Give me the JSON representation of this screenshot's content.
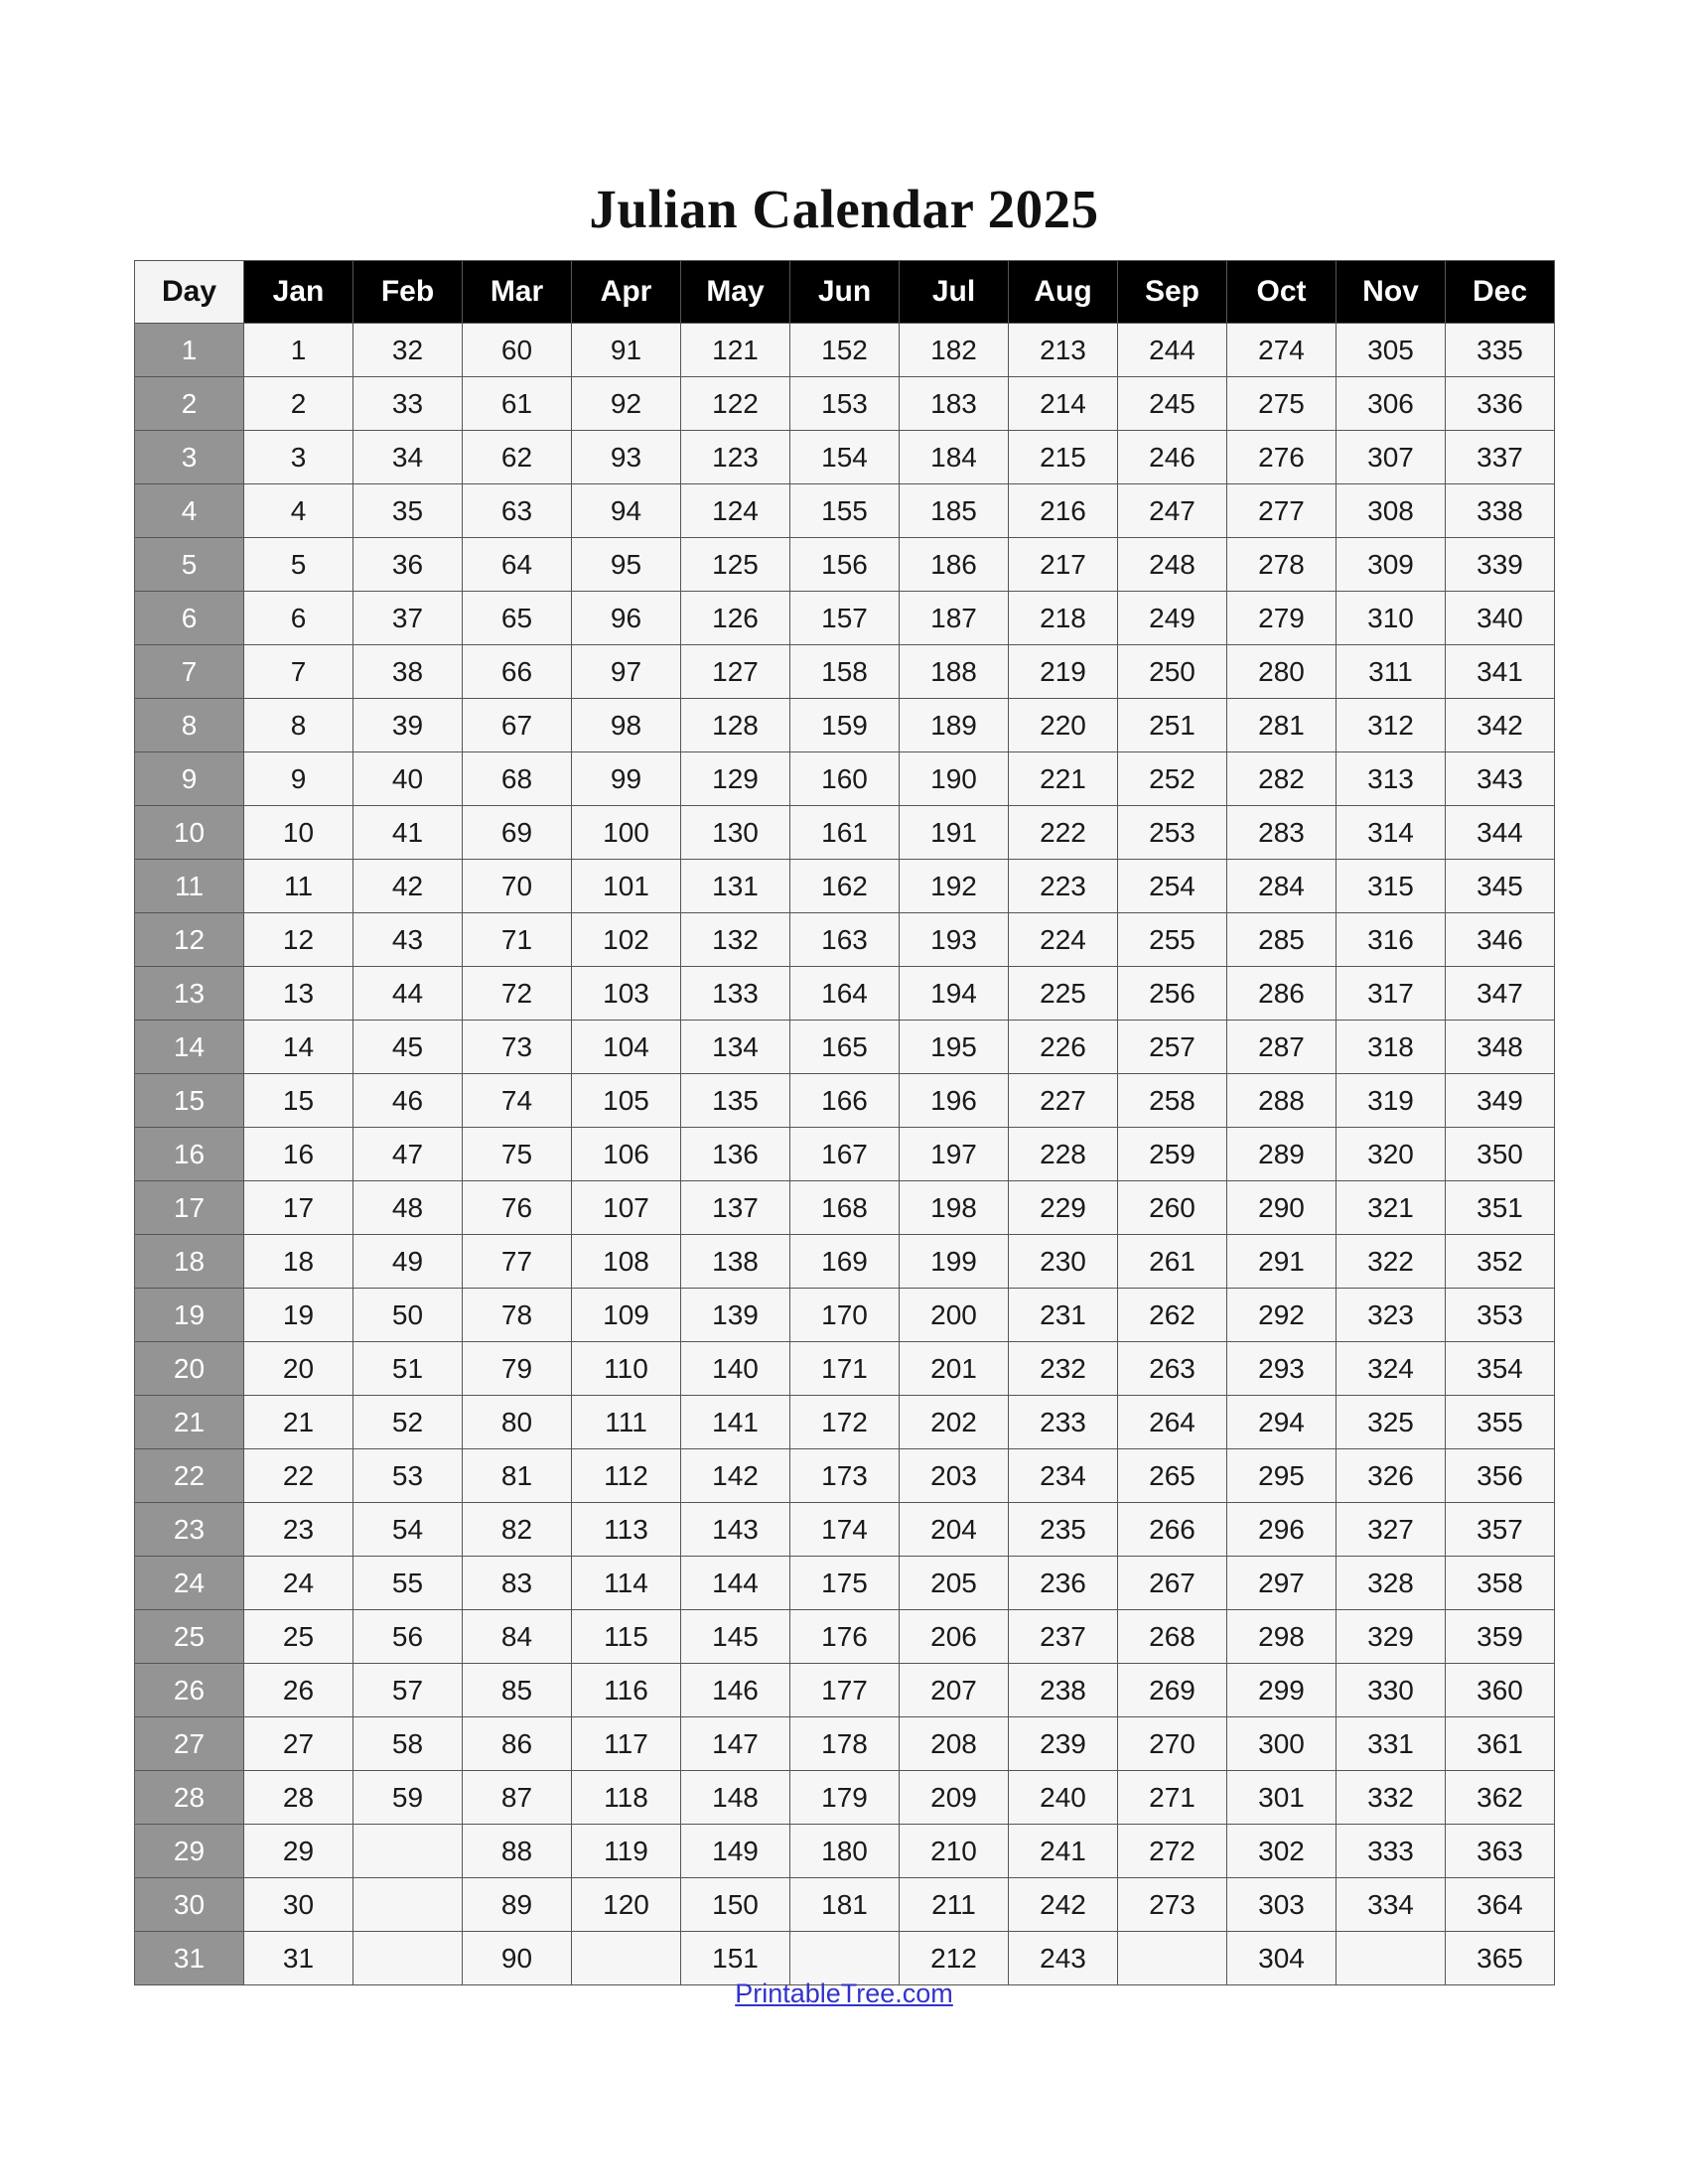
{
  "document": {
    "title": "Julian Calendar 2025",
    "year": "2025"
  },
  "table": {
    "day_header": "Day",
    "month_headers": [
      "Jan",
      "Feb",
      "Mar",
      "Apr",
      "May",
      "Jun",
      "Jul",
      "Aug",
      "Sep",
      "Oct",
      "Nov",
      "Dec"
    ],
    "day_labels": [
      "1",
      "2",
      "3",
      "4",
      "5",
      "6",
      "7",
      "8",
      "9",
      "10",
      "11",
      "12",
      "13",
      "14",
      "15",
      "16",
      "17",
      "18",
      "19",
      "20",
      "21",
      "22",
      "23",
      "24",
      "25",
      "26",
      "27",
      "28",
      "29",
      "30",
      "31"
    ],
    "rows": [
      {
        "day": "1",
        "values": [
          "1",
          "32",
          "60",
          "91",
          "121",
          "152",
          "182",
          "213",
          "244",
          "274",
          "305",
          "335"
        ]
      },
      {
        "day": "2",
        "values": [
          "2",
          "33",
          "61",
          "92",
          "122",
          "153",
          "183",
          "214",
          "245",
          "275",
          "306",
          "336"
        ]
      },
      {
        "day": "3",
        "values": [
          "3",
          "34",
          "62",
          "93",
          "123",
          "154",
          "184",
          "215",
          "246",
          "276",
          "307",
          "337"
        ]
      },
      {
        "day": "4",
        "values": [
          "4",
          "35",
          "63",
          "94",
          "124",
          "155",
          "185",
          "216",
          "247",
          "277",
          "308",
          "338"
        ]
      },
      {
        "day": "5",
        "values": [
          "5",
          "36",
          "64",
          "95",
          "125",
          "156",
          "186",
          "217",
          "248",
          "278",
          "309",
          "339"
        ]
      },
      {
        "day": "6",
        "values": [
          "6",
          "37",
          "65",
          "96",
          "126",
          "157",
          "187",
          "218",
          "249",
          "279",
          "310",
          "340"
        ]
      },
      {
        "day": "7",
        "values": [
          "7",
          "38",
          "66",
          "97",
          "127",
          "158",
          "188",
          "219",
          "250",
          "280",
          "311",
          "341"
        ]
      },
      {
        "day": "8",
        "values": [
          "8",
          "39",
          "67",
          "98",
          "128",
          "159",
          "189",
          "220",
          "251",
          "281",
          "312",
          "342"
        ]
      },
      {
        "day": "9",
        "values": [
          "9",
          "40",
          "68",
          "99",
          "129",
          "160",
          "190",
          "221",
          "252",
          "282",
          "313",
          "343"
        ]
      },
      {
        "day": "10",
        "values": [
          "10",
          "41",
          "69",
          "100",
          "130",
          "161",
          "191",
          "222",
          "253",
          "283",
          "314",
          "344"
        ]
      },
      {
        "day": "11",
        "values": [
          "11",
          "42",
          "70",
          "101",
          "131",
          "162",
          "192",
          "223",
          "254",
          "284",
          "315",
          "345"
        ]
      },
      {
        "day": "12",
        "values": [
          "12",
          "43",
          "71",
          "102",
          "132",
          "163",
          "193",
          "224",
          "255",
          "285",
          "316",
          "346"
        ]
      },
      {
        "day": "13",
        "values": [
          "13",
          "44",
          "72",
          "103",
          "133",
          "164",
          "194",
          "225",
          "256",
          "286",
          "317",
          "347"
        ]
      },
      {
        "day": "14",
        "values": [
          "14",
          "45",
          "73",
          "104",
          "134",
          "165",
          "195",
          "226",
          "257",
          "287",
          "318",
          "348"
        ]
      },
      {
        "day": "15",
        "values": [
          "15",
          "46",
          "74",
          "105",
          "135",
          "166",
          "196",
          "227",
          "258",
          "288",
          "319",
          "349"
        ]
      },
      {
        "day": "16",
        "values": [
          "16",
          "47",
          "75",
          "106",
          "136",
          "167",
          "197",
          "228",
          "259",
          "289",
          "320",
          "350"
        ]
      },
      {
        "day": "17",
        "values": [
          "17",
          "48",
          "76",
          "107",
          "137",
          "168",
          "198",
          "229",
          "260",
          "290",
          "321",
          "351"
        ]
      },
      {
        "day": "18",
        "values": [
          "18",
          "49",
          "77",
          "108",
          "138",
          "169",
          "199",
          "230",
          "261",
          "291",
          "322",
          "352"
        ]
      },
      {
        "day": "19",
        "values": [
          "19",
          "50",
          "78",
          "109",
          "139",
          "170",
          "200",
          "231",
          "262",
          "292",
          "323",
          "353"
        ]
      },
      {
        "day": "20",
        "values": [
          "20",
          "51",
          "79",
          "110",
          "140",
          "171",
          "201",
          "232",
          "263",
          "293",
          "324",
          "354"
        ]
      },
      {
        "day": "21",
        "values": [
          "21",
          "52",
          "80",
          "111",
          "141",
          "172",
          "202",
          "233",
          "264",
          "294",
          "325",
          "355"
        ]
      },
      {
        "day": "22",
        "values": [
          "22",
          "53",
          "81",
          "112",
          "142",
          "173",
          "203",
          "234",
          "265",
          "295",
          "326",
          "356"
        ]
      },
      {
        "day": "23",
        "values": [
          "23",
          "54",
          "82",
          "113",
          "143",
          "174",
          "204",
          "235",
          "266",
          "296",
          "327",
          "357"
        ]
      },
      {
        "day": "24",
        "values": [
          "24",
          "55",
          "83",
          "114",
          "144",
          "175",
          "205",
          "236",
          "267",
          "297",
          "328",
          "358"
        ]
      },
      {
        "day": "25",
        "values": [
          "25",
          "56",
          "84",
          "115",
          "145",
          "176",
          "206",
          "237",
          "268",
          "298",
          "329",
          "359"
        ]
      },
      {
        "day": "26",
        "values": [
          "26",
          "57",
          "85",
          "116",
          "146",
          "177",
          "207",
          "238",
          "269",
          "299",
          "330",
          "360"
        ]
      },
      {
        "day": "27",
        "values": [
          "27",
          "58",
          "86",
          "117",
          "147",
          "178",
          "208",
          "239",
          "270",
          "300",
          "331",
          "361"
        ]
      },
      {
        "day": "28",
        "values": [
          "28",
          "59",
          "87",
          "118",
          "148",
          "179",
          "209",
          "240",
          "271",
          "301",
          "332",
          "362"
        ]
      },
      {
        "day": "29",
        "values": [
          "29",
          "",
          "88",
          "119",
          "149",
          "180",
          "210",
          "241",
          "272",
          "302",
          "333",
          "363"
        ]
      },
      {
        "day": "30",
        "values": [
          "30",
          "",
          "89",
          "120",
          "150",
          "181",
          "211",
          "242",
          "273",
          "303",
          "334",
          "364"
        ]
      },
      {
        "day": "31",
        "values": [
          "31",
          "",
          "90",
          "",
          "151",
          "",
          "212",
          "243",
          "",
          "304",
          "",
          "365"
        ]
      }
    ]
  },
  "footer": {
    "link_text": "PrintableTree.com"
  },
  "colors": {
    "header_month_bg": "#000000",
    "header_month_text": "#ffffff",
    "header_day_bg": "#f4f4f4",
    "day_column_bg": "#949494",
    "day_column_text": "#ffffff",
    "cell_bg": "#f6f6f6",
    "cell_text": "#1a1a1a",
    "border": "#555555",
    "link": "#3233cc",
    "page_bg": "#ffffff"
  }
}
